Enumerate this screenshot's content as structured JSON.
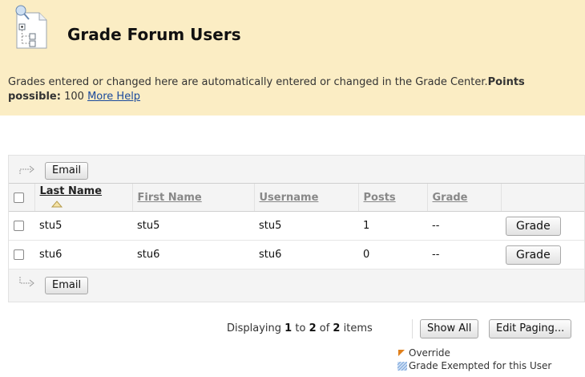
{
  "header": {
    "title": "Grade Forum Users",
    "instructions": "Grades entered or changed here are automatically entered or changed in the Grade Center.",
    "points_label": "Points possible:",
    "points_value": "100",
    "help_link": "More Help"
  },
  "actions": {
    "email_label": "Email"
  },
  "table": {
    "columns": {
      "last_name": "Last Name",
      "first_name": "First Name",
      "username": "Username",
      "posts": "Posts",
      "grade": "Grade"
    },
    "rows": [
      {
        "last_name": "stu5",
        "first_name": "stu5",
        "username": "stu5",
        "posts": "1",
        "grade": "--",
        "action": "Grade"
      },
      {
        "last_name": "stu6",
        "first_name": "stu6",
        "username": "stu6",
        "posts": "0",
        "grade": "--",
        "action": "Grade"
      }
    ]
  },
  "paging": {
    "prefix": "Displaying",
    "from": "1",
    "to_word": "to",
    "to": "2",
    "of_word": "of",
    "total": "2",
    "suffix": "items",
    "show_all_label": "Show All",
    "edit_paging_label": "Edit Paging..."
  },
  "legend": {
    "override_label": "Override",
    "exempt_label": "Grade Exempted for this User"
  },
  "icons": {
    "page": "grade-center-icon",
    "action_arrow": "arrow-icon",
    "sort": "sort-ascending-icon",
    "override": "override-flag-icon",
    "exempt": "exempt-pattern-icon"
  },
  "colors": {
    "header_bg": "#fbedc4",
    "link": "#1a4a9c",
    "override": "#e0801c",
    "exempt": "#8fb7e3"
  }
}
